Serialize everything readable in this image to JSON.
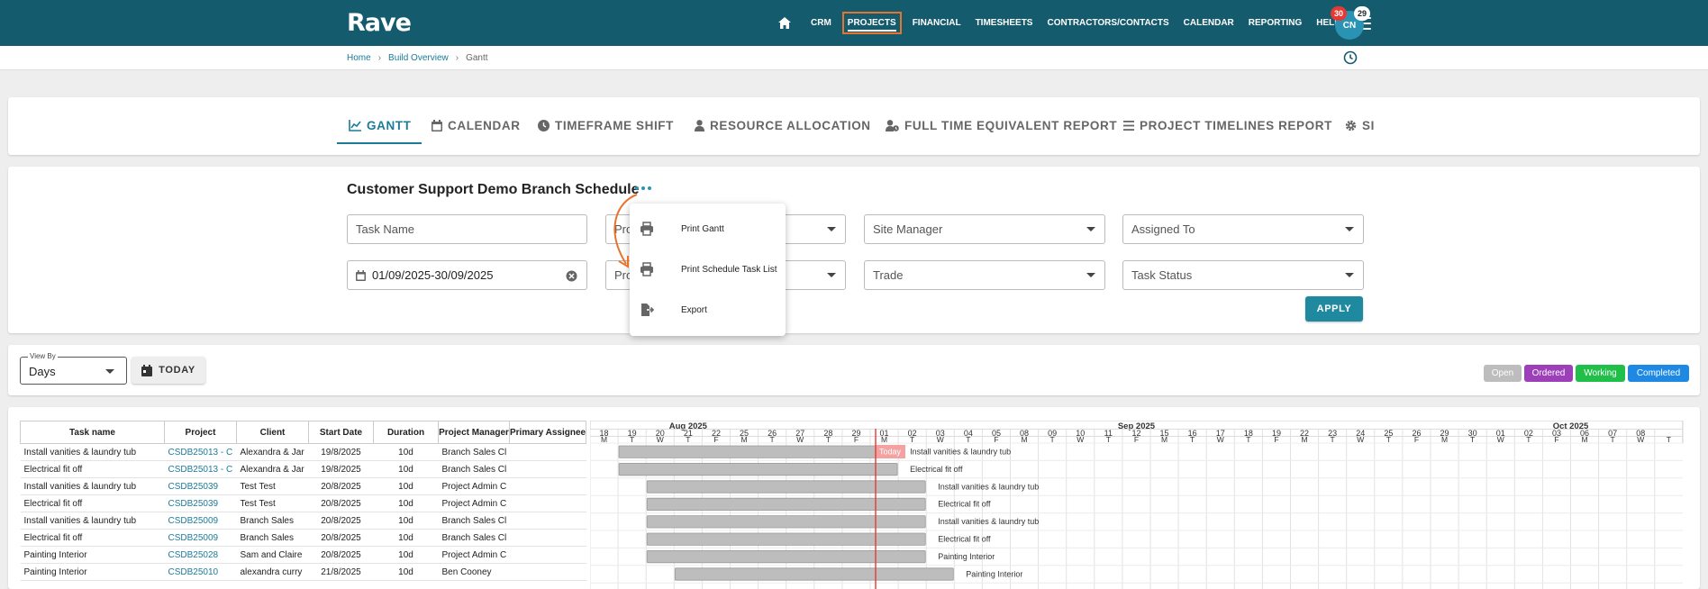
{
  "app": {
    "logo": "Rave"
  },
  "nav": {
    "items": [
      "CRM",
      "PROJECTS",
      "FINANCIAL",
      "TIMESHEETS",
      "CONTRACTORS/CONTACTS",
      "CALENDAR",
      "REPORTING",
      "HELP"
    ],
    "active": "PROJECTS",
    "avatar": "CN",
    "badge_notifications": "30",
    "badge_messages": "29"
  },
  "breadcrumb": {
    "home": "Home",
    "build": "Build Overview",
    "current": "Gantt"
  },
  "tabs": [
    "GANTT",
    "CALENDAR",
    "TIMEFRAME SHIFT",
    "RESOURCE ALLOCATION",
    "FULL TIME EQUIVALENT REPORT",
    "PROJECT TIMELINES REPORT",
    "SI"
  ],
  "filters": {
    "title": "Customer Support Demo Branch Schedule",
    "task_name_placeholder": "Task Name",
    "project_partial": "Pro",
    "project_manager_partial": "Pro",
    "site_manager": "Site Manager",
    "assigned_to": "Assigned To",
    "date_range": "01/09/2025-30/09/2025",
    "trade": "Trade",
    "task_status": "Task Status",
    "apply": "APPLY"
  },
  "menu": {
    "items": [
      "Print Gantt",
      "Print Schedule Task List",
      "Export"
    ]
  },
  "view": {
    "view_by_label": "View By",
    "view_by_value": "Days",
    "today_button": "TODAY",
    "statuses": [
      {
        "label": "Open",
        "color": "#bdbdbd"
      },
      {
        "label": "Ordered",
        "color": "#9c3fb8"
      },
      {
        "label": "Working",
        "color": "#1fbf4a"
      },
      {
        "label": "Completed",
        "color": "#1e88e5"
      }
    ]
  },
  "table": {
    "columns": [
      "Task name",
      "Project",
      "Client",
      "Start Date",
      "Duration",
      "Project Manager",
      "Primary Assignee"
    ],
    "rows": [
      [
        "Install vanities & laundry tub",
        "CSDB25013 - C",
        "Alexandra & Jar",
        "19/8/2025",
        "10d",
        "Branch Sales Cl"
      ],
      [
        "Electrical fit off",
        "CSDB25013 - C",
        "Alexandra & Jar",
        "19/8/2025",
        "10d",
        "Branch Sales Cl"
      ],
      [
        "Install vanities & laundry tub",
        "CSDB25039",
        "Test Test",
        "20/8/2025",
        "10d",
        "Project Admin C"
      ],
      [
        "Electrical fit off",
        "CSDB25039",
        "Test Test",
        "20/8/2025",
        "10d",
        "Project Admin C"
      ],
      [
        "Install vanities & laundry tub",
        "CSDB25009",
        "Branch Sales",
        "20/8/2025",
        "10d",
        "Branch Sales Cl"
      ],
      [
        "Electrical fit off",
        "CSDB25009",
        "Branch Sales",
        "20/8/2025",
        "10d",
        "Branch Sales Cl"
      ],
      [
        "Painting Interior",
        "CSDB25028",
        "Sam and Claire",
        "20/8/2025",
        "10d",
        "Project Admin C"
      ],
      [
        "Painting Interior",
        "CSDB25010",
        "alexandra curry",
        "21/8/2025",
        "10d",
        "Ben Cooney"
      ]
    ]
  },
  "gantt": {
    "months": [
      "Aug 2025",
      "Sep 2025",
      "Oct 2025"
    ],
    "days": [
      "18",
      "19",
      "20",
      "21",
      "22",
      "25",
      "26",
      "27",
      "28",
      "29",
      "01",
      "02",
      "03",
      "04",
      "05",
      "08",
      "09",
      "10",
      "11",
      "12",
      "15",
      "16",
      "17",
      "18",
      "19",
      "22",
      "23",
      "24",
      "25",
      "26",
      "29",
      "30",
      "01",
      "02",
      "03",
      "06",
      "07",
      "08"
    ],
    "weekdays": [
      "M",
      "T",
      "W",
      "T",
      "F",
      "M",
      "T",
      "W",
      "T",
      "F",
      "M",
      "T",
      "W",
      "T",
      "F",
      "M",
      "T",
      "W",
      "T",
      "F",
      "M",
      "T",
      "W",
      "T",
      "F",
      "M",
      "T",
      "W",
      "T",
      "F",
      "M",
      "T",
      "W",
      "T",
      "F",
      "M",
      "T",
      "W",
      "T"
    ],
    "today_label": "Today",
    "bars": [
      {
        "label": "Install vanities & laundry tub"
      },
      {
        "label": "Electrical fit off"
      },
      {
        "label": "Install vanities & laundry tub"
      },
      {
        "label": "Electrical fit off"
      },
      {
        "label": "Install vanities & laundry tub"
      },
      {
        "label": "Electrical fit off"
      },
      {
        "label": "Painting Interior"
      },
      {
        "label": "Painting Interior"
      }
    ]
  }
}
